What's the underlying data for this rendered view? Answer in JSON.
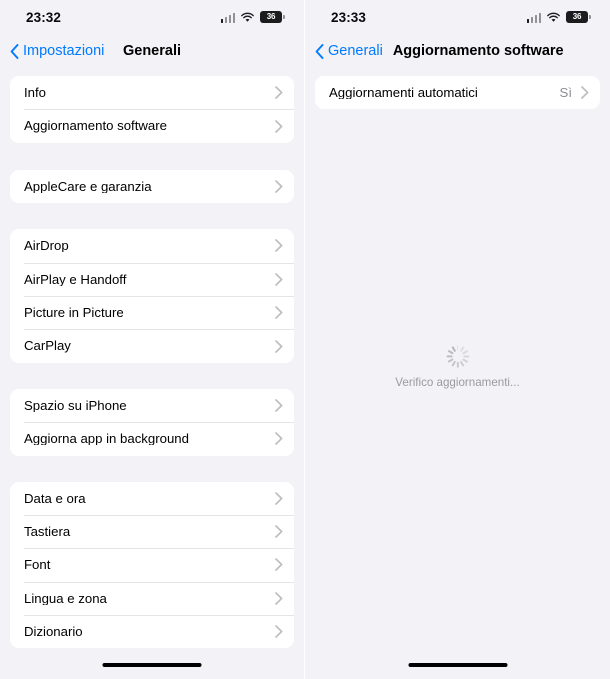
{
  "left": {
    "status": {
      "time": "23:32",
      "battery_level": "36"
    },
    "nav": {
      "back_label": "Impostazioni",
      "title": "Generali"
    },
    "groups": [
      {
        "rows": [
          {
            "label": "Info",
            "value": ""
          },
          {
            "label": "Aggiornamento software",
            "value": ""
          }
        ]
      },
      {
        "rows": [
          {
            "label": "AppleCare e garanzia",
            "value": ""
          }
        ]
      },
      {
        "rows": [
          {
            "label": "AirDrop",
            "value": ""
          },
          {
            "label": "AirPlay e Handoff",
            "value": ""
          },
          {
            "label": "Picture in Picture",
            "value": ""
          },
          {
            "label": "CarPlay",
            "value": ""
          }
        ]
      },
      {
        "rows": [
          {
            "label": "Spazio su iPhone",
            "value": ""
          },
          {
            "label": "Aggiorna app in background",
            "value": ""
          }
        ]
      },
      {
        "rows": [
          {
            "label": "Data e ora",
            "value": ""
          },
          {
            "label": "Tastiera",
            "value": ""
          },
          {
            "label": "Font",
            "value": ""
          },
          {
            "label": "Lingua e zona",
            "value": ""
          },
          {
            "label": "Dizionario",
            "value": ""
          }
        ]
      }
    ]
  },
  "right": {
    "status": {
      "time": "23:33",
      "battery_level": "36"
    },
    "nav": {
      "back_label": "Generali",
      "title": "Aggiornamento software"
    },
    "groups": [
      {
        "rows": [
          {
            "label": "Aggiornamenti automatici",
            "value": "Sì"
          }
        ]
      }
    ],
    "loading": {
      "text": "Verifico aggiornamenti..."
    }
  },
  "colors": {
    "accent": "#007AFF",
    "background": "#F2F2F7",
    "card": "#FFFFFF",
    "separator": "#E4E4E8",
    "secondary_text": "#8E8E93"
  },
  "icons": {
    "back_chevron": "chevron-left-icon",
    "row_chevron": "chevron-right-icon",
    "wifi": "wifi-icon",
    "cellular": "cellular-signal-icon",
    "battery": "battery-icon",
    "spinner": "spinner-icon",
    "home_indicator": "home-indicator"
  }
}
